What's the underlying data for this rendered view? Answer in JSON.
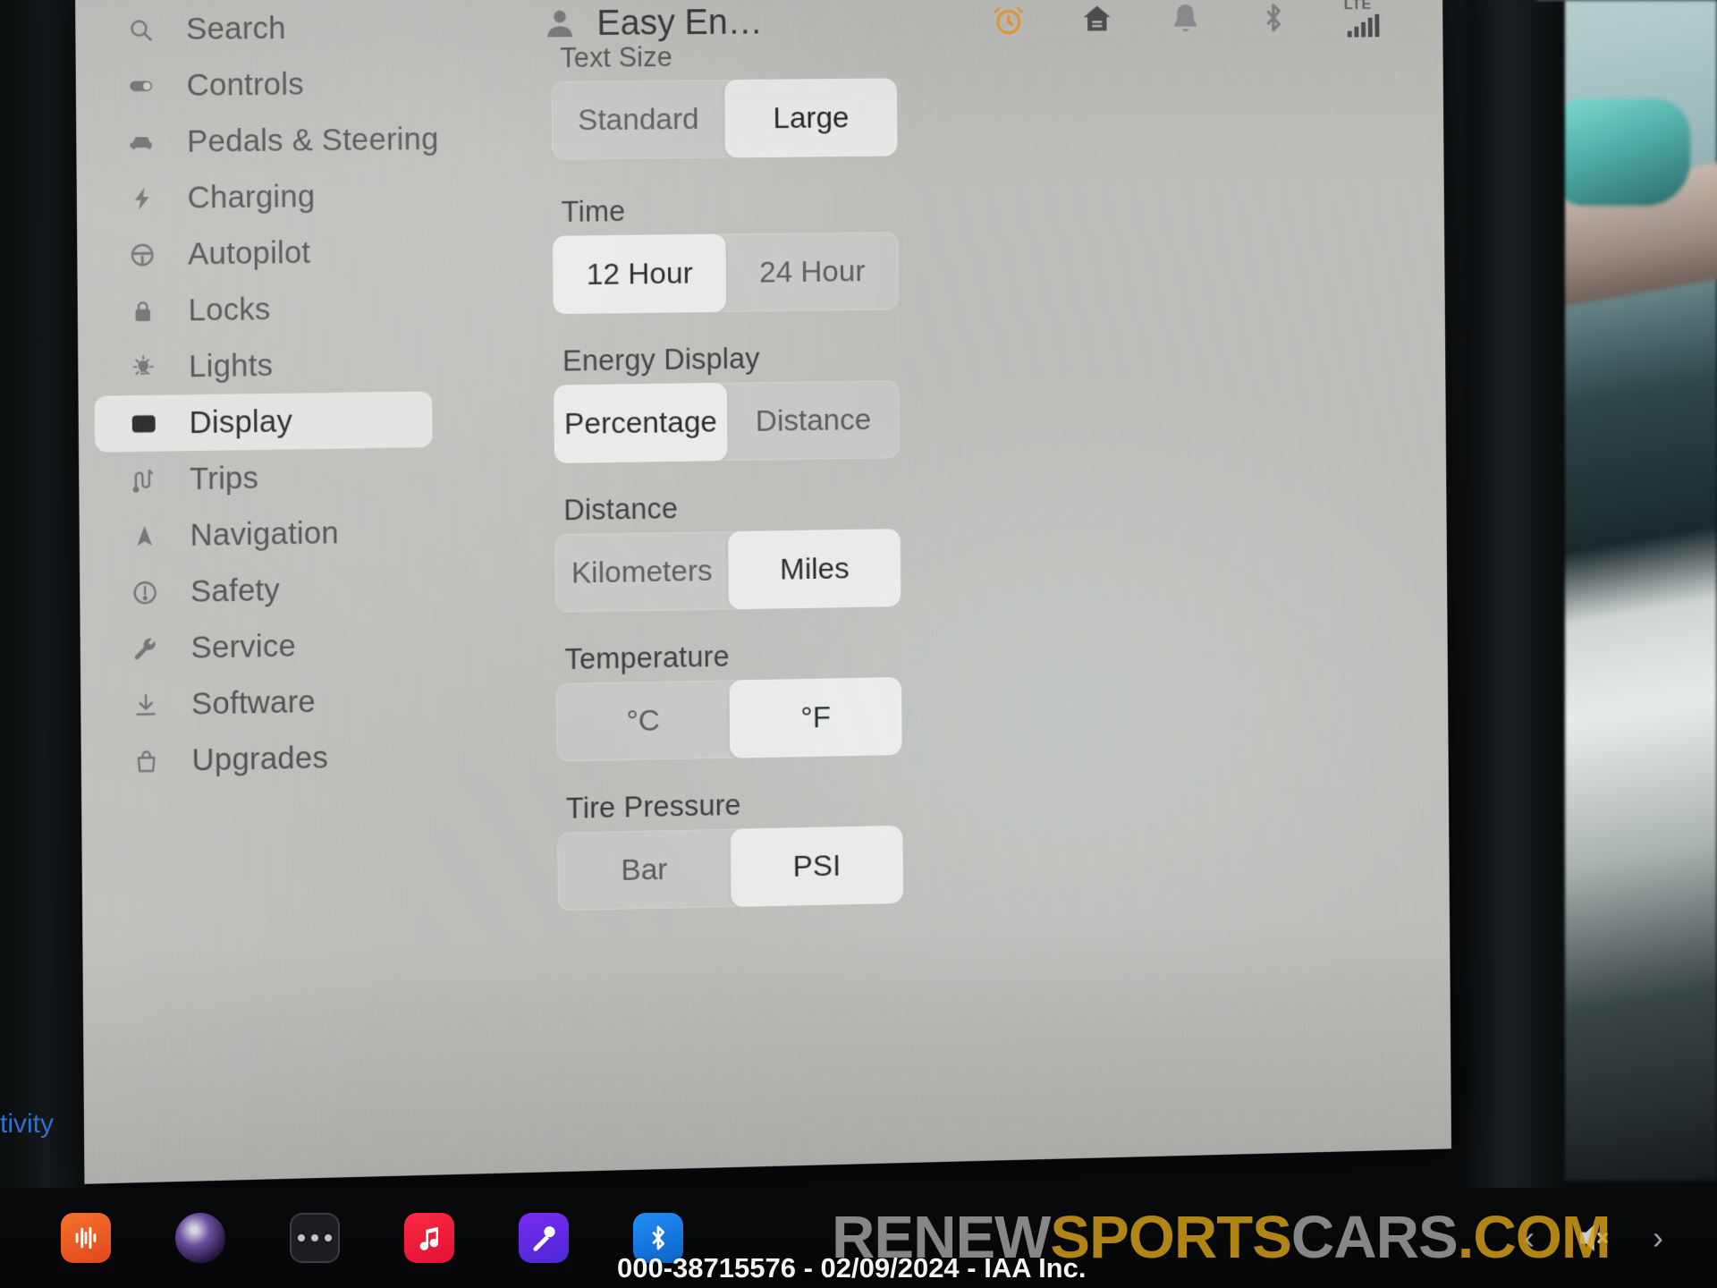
{
  "header": {
    "profile_icon": "person-icon",
    "profile_name": "Easy En…",
    "status_icons": [
      {
        "name": "alarm-clock-icon",
        "color": "#e8962f"
      },
      {
        "name": "home-icon",
        "color": "#4b4d4f"
      },
      {
        "name": "bell-icon",
        "color": "#85888a"
      },
      {
        "name": "bluetooth-icon",
        "color": "#7e8183"
      }
    ],
    "network": {
      "label": "LTE",
      "bars": 5
    }
  },
  "sidebar": {
    "items": [
      {
        "label": "Search",
        "icon": "search-icon",
        "selected": false
      },
      {
        "label": "Controls",
        "icon": "toggle-icon",
        "selected": false
      },
      {
        "label": "Pedals & Steering",
        "icon": "car-icon",
        "selected": false
      },
      {
        "label": "Charging",
        "icon": "bolt-icon",
        "selected": false
      },
      {
        "label": "Autopilot",
        "icon": "steering-wheel-icon",
        "selected": false
      },
      {
        "label": "Locks",
        "icon": "lock-icon",
        "selected": false
      },
      {
        "label": "Lights",
        "icon": "light-bulb-icon",
        "selected": false
      },
      {
        "label": "Display",
        "icon": "display-icon",
        "selected": true
      },
      {
        "label": "Trips",
        "icon": "trips-route-icon",
        "selected": false
      },
      {
        "label": "Navigation",
        "icon": "navigation-arrow-icon",
        "selected": false
      },
      {
        "label": "Safety",
        "icon": "exclamation-circle-icon",
        "selected": false
      },
      {
        "label": "Service",
        "icon": "wrench-icon",
        "selected": false
      },
      {
        "label": "Software",
        "icon": "download-icon",
        "selected": false
      },
      {
        "label": "Upgrades",
        "icon": "shopping-bag-icon",
        "selected": false
      }
    ],
    "edge_tab_label": "tivity"
  },
  "panel": {
    "groups": [
      {
        "title": "Text Size",
        "options": [
          {
            "label": "Standard",
            "selected": false
          },
          {
            "label": "Large",
            "selected": true
          }
        ]
      },
      {
        "title": "Time",
        "options": [
          {
            "label": "12 Hour",
            "selected": true
          },
          {
            "label": "24 Hour",
            "selected": false
          }
        ]
      },
      {
        "title": "Energy Display",
        "options": [
          {
            "label": "Percentage",
            "selected": true
          },
          {
            "label": "Distance",
            "selected": false
          }
        ]
      },
      {
        "title": "Distance",
        "options": [
          {
            "label": "Kilometers",
            "selected": false
          },
          {
            "label": "Miles",
            "selected": true
          }
        ]
      },
      {
        "title": "Temperature",
        "options": [
          {
            "label": "°C",
            "selected": false
          },
          {
            "label": "°F",
            "selected": true
          }
        ]
      },
      {
        "title": "Tire Pressure",
        "options": [
          {
            "label": "Bar",
            "selected": false
          },
          {
            "label": "PSI",
            "selected": true
          }
        ]
      }
    ]
  },
  "taskbar": {
    "apps": [
      {
        "name": "waveform-app-icon",
        "color": "#f4722b"
      },
      {
        "name": "media-orb-app-icon",
        "color": "#6b4f9e"
      },
      {
        "name": "more-apps-icon",
        "color": "#1b1d20"
      },
      {
        "name": "music-app-icon",
        "color": "#fb2b44"
      },
      {
        "name": "karaoke-mic-app-icon",
        "color": "#7b2bf0"
      },
      {
        "name": "bluetooth-app-icon",
        "color": "#1f8ff5"
      }
    ],
    "mute_icon": "speaker-mute-icon",
    "prev_icon": "chevron-left-icon",
    "next_icon": "chevron-right-icon"
  },
  "watermark": {
    "brand_part1": "RENEW",
    "brand_part2": "SPORTS",
    "brand_part3": "CARS",
    "brand_part4": ".COM",
    "lot_text": "000-38715576 - 02/09/2024 - IAA Inc."
  }
}
